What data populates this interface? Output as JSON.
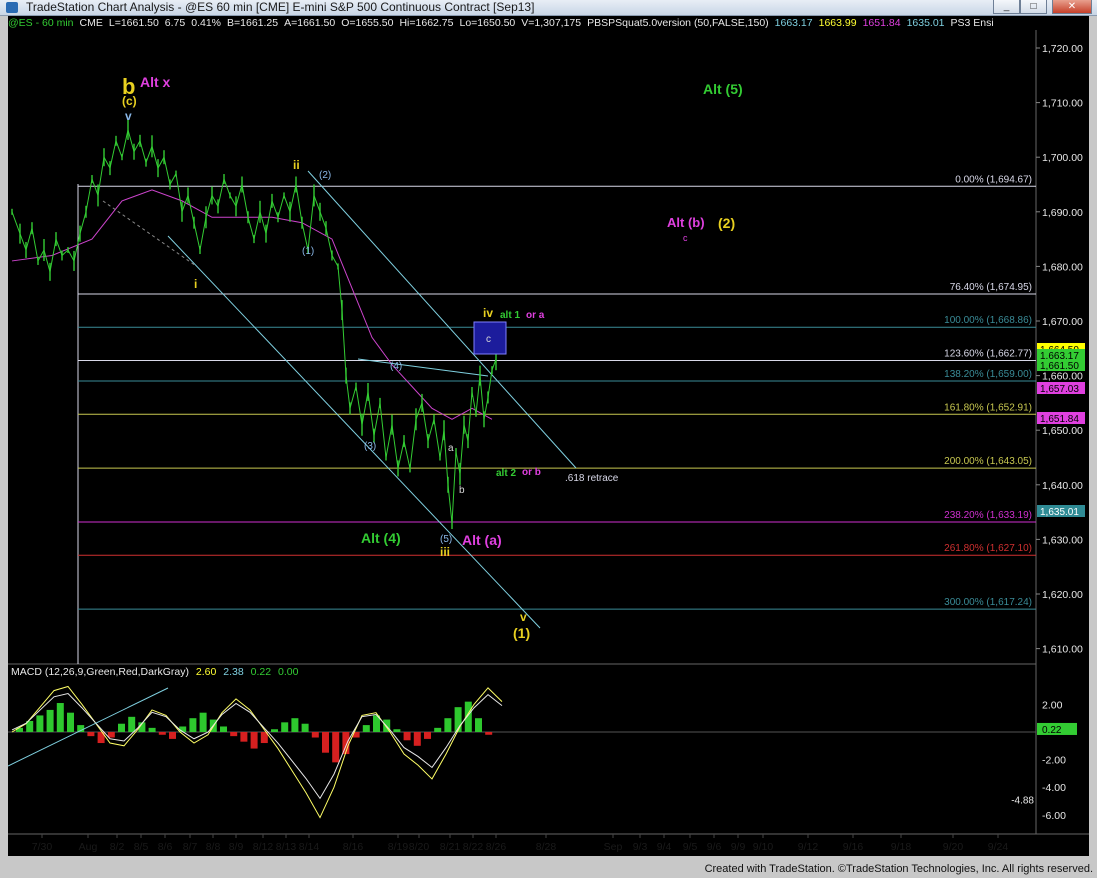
{
  "window": {
    "title": "TradeStation Chart Analysis - @ES 60 min [CME] E-mini S&P 500 Continuous Contract [Sep13]",
    "minimize": "_",
    "maximize": "□",
    "close": "✕"
  },
  "header": {
    "symbol": "@ES - 60 min",
    "exchange": "CME",
    "last": "L=1661.50",
    "change": "6.75",
    "pct": "0.41%",
    "bid": "B=1661.25",
    "ask": "A=1661.50",
    "open": "O=1655.50",
    "high": "Hi=1662.75",
    "low": "Lo=1650.50",
    "volume": "V=1,307,175",
    "indicator": "PBSPSquat5.0version (50,FALSE,150)",
    "ind_values": [
      "1663.17",
      "1663.99",
      "1651.84",
      "1635.01"
    ],
    "ind2": "PS3 Ensi"
  },
  "colors": {
    "background": "#000000",
    "price": "#33cc33",
    "ma": "#cc44cc",
    "channel": "#7fd0e0",
    "fib_white": "#d8d8e8",
    "fib_yellow": "#c8c850",
    "fib_magenta": "#d030d0",
    "fib_red": "#d03030",
    "fib_teal": "#3a8c98",
    "label_yellow": "#e8d020",
    "label_green": "#33cc33",
    "label_magenta": "#e040e0",
    "label_blue": "#8ab8e8"
  },
  "price_axis": {
    "ticks": [
      "1,720.00",
      "1,710.00",
      "1,700.00",
      "1,690.00",
      "1,680.00",
      "1,670.00",
      "1,660.00",
      "1,650.00",
      "1,640.00",
      "1,630.00",
      "1,620.00",
      "1,610.00"
    ],
    "markers": [
      {
        "label": "1,664.50",
        "color": "#ffff00",
        "tc": "#000"
      },
      {
        "label": "1,663.17",
        "color": "#33cc33",
        "tc": "#000"
      },
      {
        "label": "1,661.50",
        "color": "#33cc33",
        "tc": "#000"
      },
      {
        "label": "1,657.03",
        "color": "#e040e0",
        "tc": "#000"
      },
      {
        "label": "1,651.84",
        "color": "#e040e0",
        "tc": "#000"
      },
      {
        "label": "1,635.01",
        "color": "#2f8b95",
        "tc": "#fff"
      }
    ]
  },
  "macd_axis": {
    "title": "MACD (12,26,9,Green,Red,DarkGray)",
    "values": [
      "2.60",
      "2.38",
      "0.22",
      "0.00"
    ],
    "ticks": [
      "2.00",
      "-2.00",
      "-4.00",
      "-6.00"
    ],
    "marker_value": "0.22",
    "marker_low": "-4.88"
  },
  "fibs": [
    {
      "label": "0.00% (1,694.67)",
      "color": "#d8d8e8"
    },
    {
      "label": "76.40% (1,674.95)",
      "color": "#d8d8e8"
    },
    {
      "label": "100.00% (1,668.86)",
      "color": "#3a8c98"
    },
    {
      "label": "123.60% (1,662.77)",
      "color": "#d8d8e8"
    },
    {
      "label": "138.20% (1,659.00)",
      "color": "#3a8c98"
    },
    {
      "label": "161.80% (1,652.91)",
      "color": "#c8c850"
    },
    {
      "label": "200.00% (1,643.05)",
      "color": "#c8c850"
    },
    {
      "label": "238.20% (1,633.19)",
      "color": "#d030d0"
    },
    {
      "label": "261.80% (1,627.10)",
      "color": "#d03030"
    },
    {
      "label": "300.00% (1,617.24)",
      "color": "#3a8c98"
    }
  ],
  "wave_labels": {
    "b": "b",
    "c_paren": "(c)",
    "alt_x": "Alt x",
    "v_top": "v",
    "ii": "ii",
    "two_paren": "(2)",
    "i": "i",
    "one_paren": "(1)",
    "four_paren": "(4)",
    "three_paren": "(3)",
    "five_paren": "(5)",
    "iii": "iii",
    "alt_four": "Alt (4)",
    "alt_a": "Alt (a)",
    "a": "a",
    "b_small": "b",
    "iv": "iv",
    "alt1": "alt 1",
    "or_a": "or a",
    "c_box": "c",
    "alt2": "alt 2",
    "or_b": "or b",
    "retrace": ".618 retrace",
    "v_bottom": "v",
    "one_bottom": "(1)",
    "alt_five": "Alt (5)",
    "alt_b": "Alt (b)",
    "two_right": "(2)",
    "c_small": "c"
  },
  "date_axis": [
    "7/30",
    "Aug",
    "8/2",
    "8/5",
    "8/6",
    "8/7",
    "8/8",
    "8/9",
    "8/12",
    "8/13",
    "8/14",
    "8/16",
    "8/19",
    "8/20",
    "8/21",
    "8/22",
    "8/26",
    "8/28",
    "Sep",
    "9/3",
    "9/4",
    "9/5",
    "9/6",
    "9/9",
    "9/10",
    "9/12",
    "9/16",
    "9/18",
    "9/20",
    "9/24"
  ],
  "status": "Created with TradeStation. ©TradeStation Technologies, Inc. All rights reserved."
}
